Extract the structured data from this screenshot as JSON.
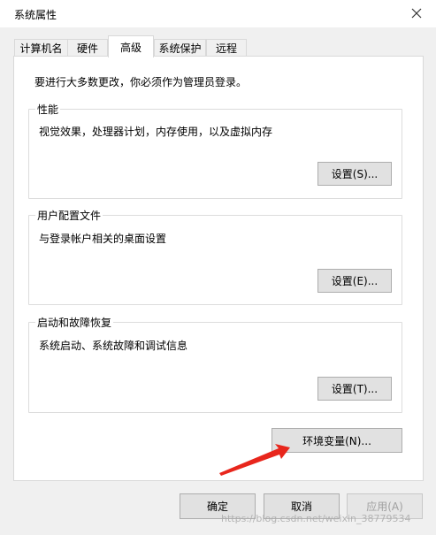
{
  "window": {
    "title": "系统属性"
  },
  "tabs": [
    {
      "label": "计算机名"
    },
    {
      "label": "硬件"
    },
    {
      "label": "高级",
      "active": true
    },
    {
      "label": "系统保护"
    },
    {
      "label": "远程"
    }
  ],
  "advanced": {
    "admin_note": "要进行大多数更改，你必须作为管理员登录。",
    "performance": {
      "title": "性能",
      "description": "视觉效果，处理器计划，内存使用，以及虚拟内存",
      "button": "设置(S)..."
    },
    "user_profiles": {
      "title": "用户配置文件",
      "description": "与登录帐户相关的桌面设置",
      "button": "设置(E)..."
    },
    "startup_recovery": {
      "title": "启动和故障恢复",
      "description": "系统启动、系统故障和调试信息",
      "button": "设置(T)..."
    },
    "env_button": "环境变量(N)..."
  },
  "footer": {
    "ok": "确定",
    "cancel": "取消",
    "apply": "应用(A)"
  },
  "annotation": {
    "arrow_color": "#e8261c"
  },
  "watermark": "https://blog.csdn.net/weixin_38779534",
  "icons": {
    "close": "close-icon"
  }
}
